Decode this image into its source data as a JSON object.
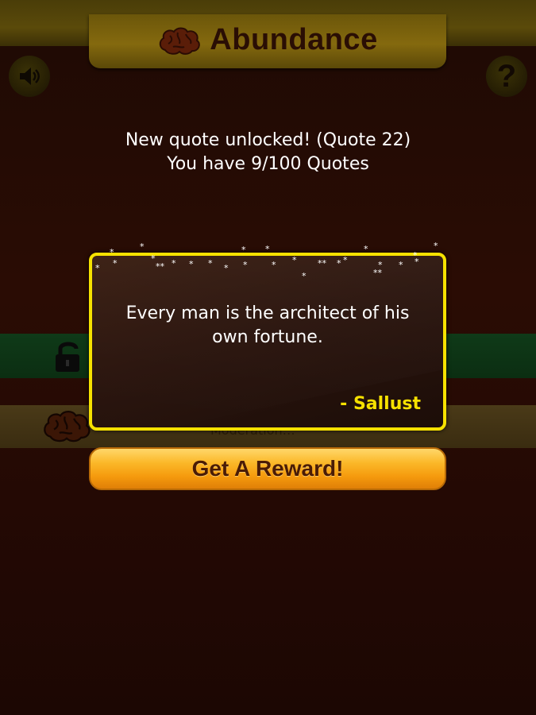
{
  "header": {
    "title": "Abundance",
    "logo_icon": "brain-icon",
    "sound_icon": "speaker-icon",
    "help_label": "?"
  },
  "message": {
    "line1": "New quote unlocked! (Quote 22)",
    "line2": "You have 9/100 Quotes"
  },
  "popup": {
    "quote": "Every man is the architect of his own fortune.",
    "author": "- Sallust",
    "border_color": "#f6e100"
  },
  "background_list": {
    "locked_icon": "lock-icon",
    "row_icon": "brain-icon",
    "row_text": "Moderation…"
  },
  "reward_button": {
    "label": "Get A Reward!"
  }
}
